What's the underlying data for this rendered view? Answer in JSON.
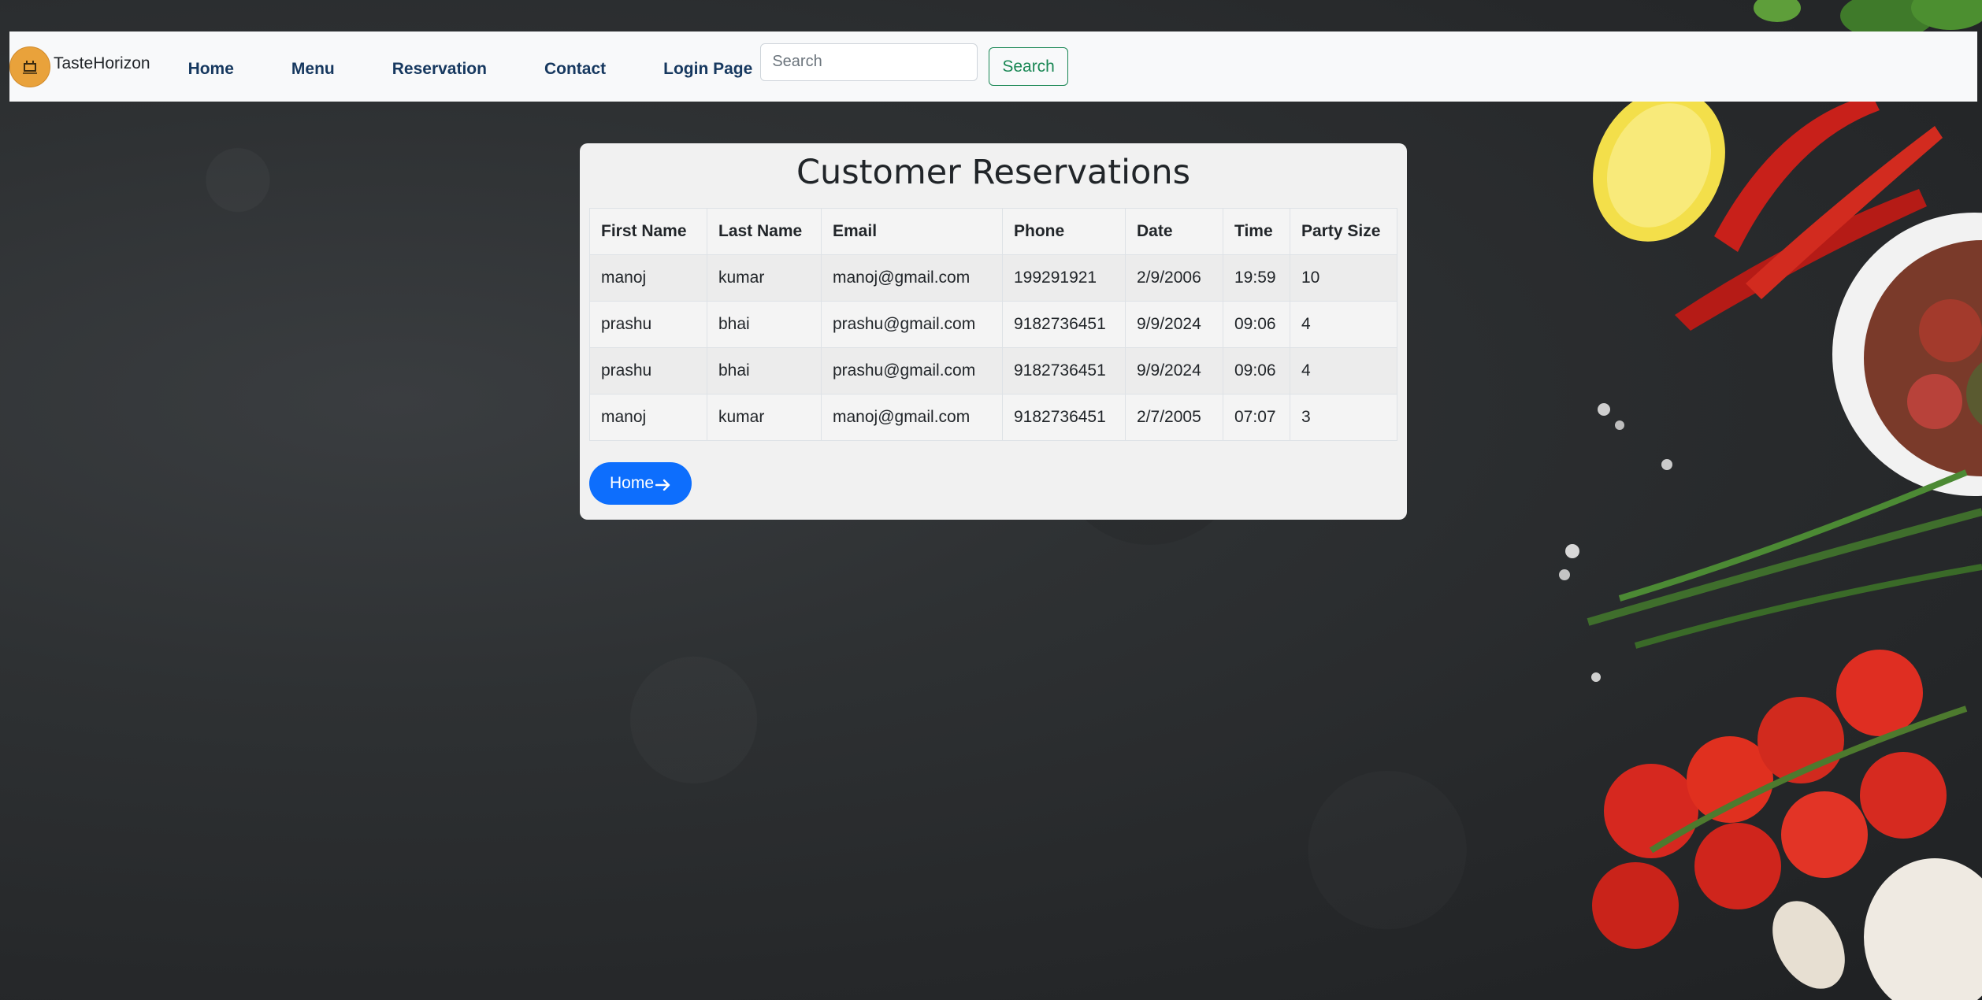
{
  "navbar": {
    "brand": "TasteHorizon",
    "links": [
      "Home",
      "Menu",
      "Reservation",
      "Contact",
      "Login Page"
    ],
    "search_placeholder": "Search",
    "search_button": "Search"
  },
  "reservations": {
    "title": "Customer Reservations",
    "columns": [
      "First Name",
      "Last Name",
      "Email",
      "Phone",
      "Date",
      "Time",
      "Party Size"
    ],
    "rows": [
      [
        "manoj",
        "kumar",
        "manoj@gmail.com",
        "199291921",
        "2/9/2006",
        "19:59",
        "10"
      ],
      [
        "prashu",
        "bhai",
        "prashu@gmail.com",
        "9182736451",
        "9/9/2024",
        "09:06",
        "4"
      ],
      [
        "prashu",
        "bhai",
        "prashu@gmail.com",
        "9182736451",
        "9/9/2024",
        "09:06",
        "4"
      ],
      [
        "manoj",
        "kumar",
        "manoj@gmail.com",
        "9182736451",
        "2/7/2005",
        "07:07",
        "3"
      ]
    ],
    "home_button": "Home"
  },
  "icons": {
    "logo": "restaurant-logo-icon",
    "home_arrow": "arrow-right-icon"
  },
  "colors": {
    "primary": "#0d6efd",
    "success": "#198754",
    "nav_text": "#16385f",
    "navbar_bg": "#f8f9fa"
  }
}
